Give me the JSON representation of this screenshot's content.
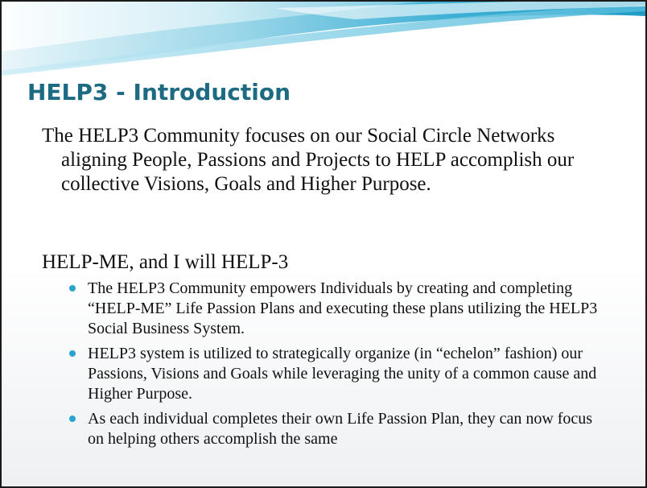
{
  "slide": {
    "title": "HELP3 - Introduction",
    "paragraph1": "The HELP3 Community focuses on our Social Circle Networks aligning People, Passions and Projects to HELP accomplish our collective Visions, Goals and Higher Purpose.",
    "paragraph2": "HELP-ME, and I will HELP-3",
    "bullets": [
      "The HELP3 Community empowers Individuals by creating and completing “HELP-ME” Life Passion Plans and executing these plans utilizing the HELP3 Social Business System.",
      "HELP3 system is utilized to strategically organize (in “echelon” fashion) our  Passions, Visions and Goals while leveraging the unity of a common cause and Higher Purpose.",
      "As each individual completes their own Life Passion Plan, they can now focus on helping others accomplish the same"
    ]
  },
  "colors": {
    "title": "#1d6b82",
    "bullet": "#2aa3cf",
    "wave_dark": "#1f9cc4",
    "wave_light": "#bfe6f2"
  }
}
